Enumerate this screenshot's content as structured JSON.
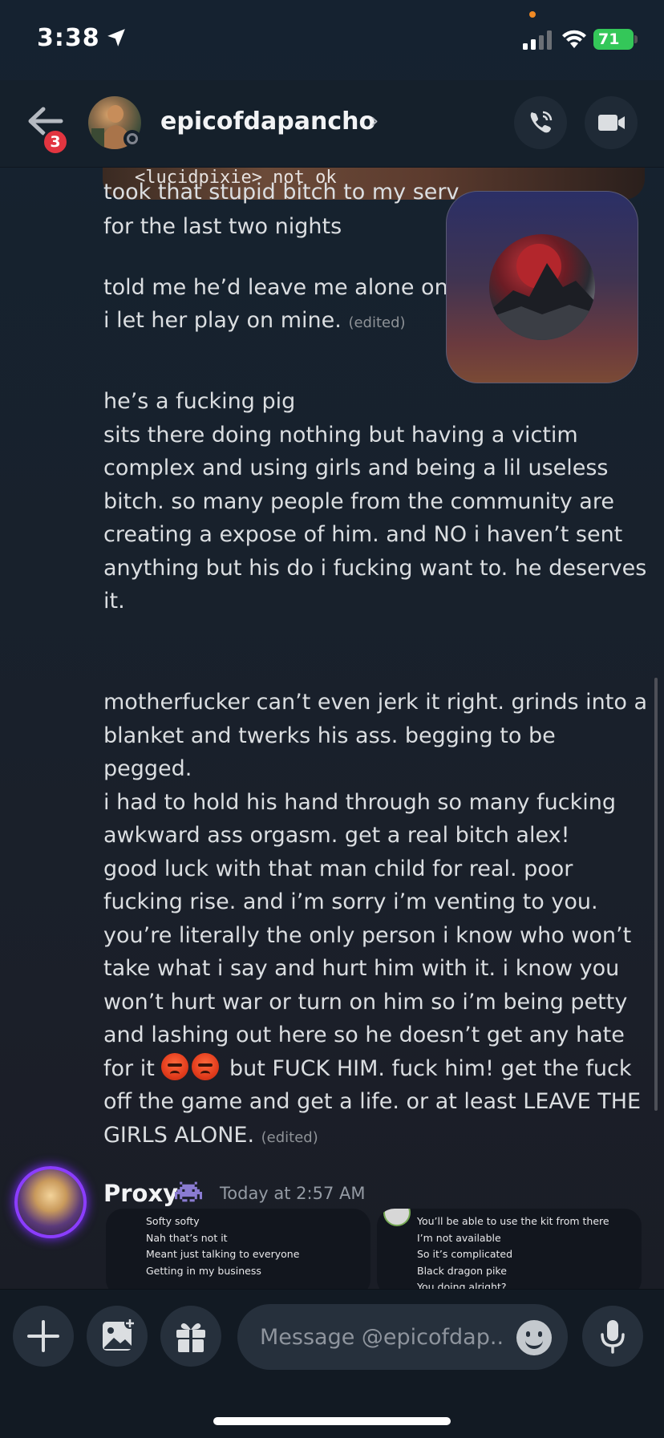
{
  "status_bar": {
    "time": "3:38",
    "battery": "71"
  },
  "header": {
    "badge_count": "3",
    "username": "epicofdapancho",
    "chevron": "›"
  },
  "chat": {
    "top_image_text": "<lucidpixie>  not ok",
    "messages": [
      {
        "text": "took that stupid bitch to my serv"
      },
      {
        "text": "for the last two nights"
      },
      {
        "text": "told me he’d leave me alone on t",
        "text2": "f",
        "text3": "i let her play on mine.",
        "edited": "(edited)"
      },
      {
        "text": "he’s a fucking pig\nsits there doing nothing but having a victim\ncomplex and using girls and being a lil useless\nbitch. so many people from the community are\ncreating a expose of him. and NO i haven’t sent\nanything but his do i fucking want to. he deserves\nit."
      },
      {
        "text": "motherfucker can’t even jerk it right. grinds into a\nblanket and twerks his ass. begging to be pegged.\ni had to hold his hand through so many fucking\nawkward ass orgasm. get a real bitch alex!\ngood luck with that man child for real. poor\nfucking rise. and i’m sorry i’m venting to you.\nyou’re literally the only person i know who won’t\ntake what i say and hurt him with it. i know you\nwon’t hurt war or turn on him so i’m being petty\nand lashing out here so he doesn’t get any hate\nfor it",
        "after_emoji": " but FUCK HIM. fuck him! get the fuck\noff the game and get a life. or at least LEAVE THE\nGIRLS ALONE.",
        "edited": "(edited)"
      }
    ],
    "next_author": {
      "name": "Proxy",
      "timestamp": "Today at 2:57 AM"
    },
    "attachments": [
      {
        "lines": [
          "Softy softy",
          "Nah that’s not it",
          "Meant just talking to everyone",
          "Getting in my business"
        ]
      },
      {
        "lines": [
          "You’ll be able to use the kit from there",
          "I’m not available",
          "So it’s complicated",
          "Black dragon pike",
          "You doing alright?"
        ]
      }
    ]
  },
  "composer": {
    "placeholder": "Message @epicofdap.."
  },
  "colors": {
    "background": "#16202c",
    "header": "#15202b",
    "badge": "#e23540",
    "battery": "#34c759",
    "proxy_ring": "#8b3dff"
  },
  "icons": [
    "location-arrow-icon",
    "signal-icon",
    "wifi-icon",
    "back-arrow-icon",
    "phone-call-icon",
    "video-camera-icon",
    "space-invader-icon",
    "plus-icon",
    "image-icon",
    "gift-icon",
    "emoji-icon",
    "microphone-icon"
  ]
}
